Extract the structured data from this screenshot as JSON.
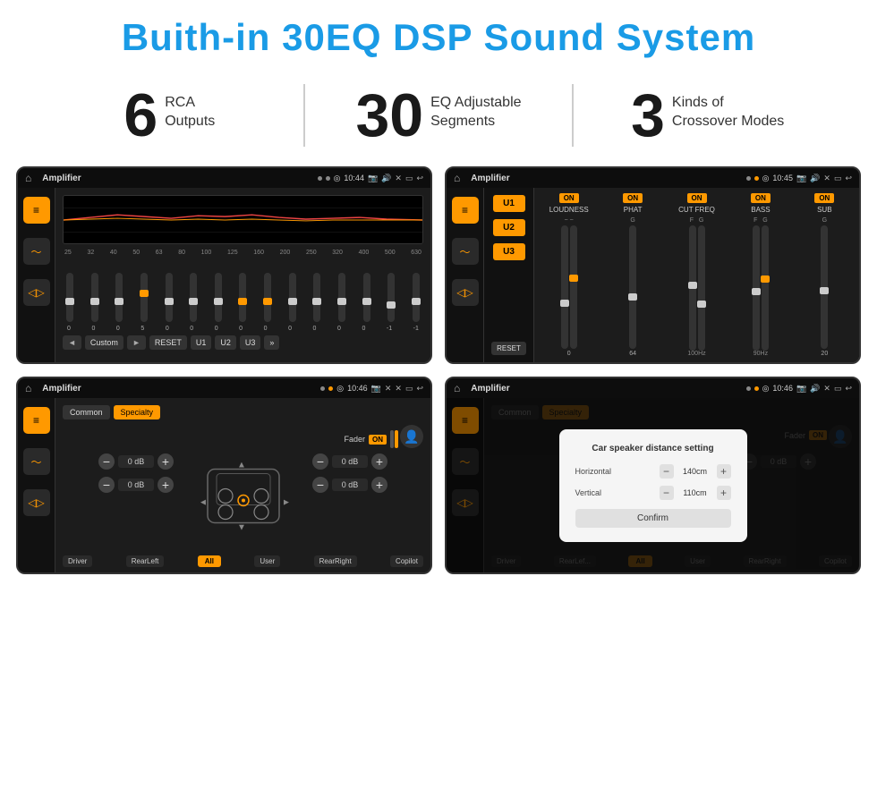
{
  "header": {
    "title": "Buith-in 30EQ DSP Sound System"
  },
  "stats": [
    {
      "number": "6",
      "label": "RCA\nOutputs"
    },
    {
      "number": "30",
      "label": "EQ Adjustable\nSegments"
    },
    {
      "number": "3",
      "label": "Kinds of\nCrossover Modes"
    }
  ],
  "screens": {
    "screen1": {
      "title": "Amplifier",
      "time": "10:44",
      "eq_freqs": [
        "25",
        "32",
        "40",
        "50",
        "63",
        "80",
        "100",
        "125",
        "160",
        "200",
        "250",
        "320",
        "400",
        "500",
        "630"
      ],
      "eq_values": [
        "0",
        "0",
        "0",
        "5",
        "0",
        "0",
        "0",
        "0",
        "0",
        "0",
        "0",
        "0",
        "0",
        "-1",
        "0",
        "-1"
      ],
      "preset": "Custom",
      "buttons": [
        "RESET",
        "U1",
        "U2",
        "U3"
      ]
    },
    "screen2": {
      "title": "Amplifier",
      "time": "10:45",
      "u_buttons": [
        "U1",
        "U2",
        "U3"
      ],
      "columns": [
        {
          "label": "LOUDNESS",
          "on": true
        },
        {
          "label": "PHAT",
          "on": true
        },
        {
          "label": "CUT FREQ",
          "on": true
        },
        {
          "label": "BASS",
          "on": true
        },
        {
          "label": "SUB",
          "on": true
        }
      ],
      "reset": "RESET"
    },
    "screen3": {
      "title": "Amplifier",
      "time": "10:46",
      "tabs": [
        "Common",
        "Specialty"
      ],
      "fader": "Fader",
      "fader_on": "ON",
      "db_rows": [
        {
          "left": "0 dB",
          "right": "0 dB"
        },
        {
          "left": "0 dB",
          "right": "0 dB"
        }
      ],
      "bottom_labels": [
        "Driver",
        "RearLeft",
        "All",
        "User",
        "RearRight",
        "Copilot"
      ]
    },
    "screen4": {
      "title": "Amplifier",
      "time": "10:46",
      "tabs": [
        "Common",
        "Specialty"
      ],
      "dialog": {
        "title": "Car speaker distance setting",
        "horizontal_label": "Horizontal",
        "horizontal_value": "140cm",
        "vertical_label": "Vertical",
        "vertical_value": "110cm",
        "confirm_label": "Confirm"
      },
      "db_right": "0 dB",
      "bottom_labels": [
        "Driver",
        "RearLef...",
        "All",
        "User",
        "RearRight",
        "Copilot"
      ]
    }
  }
}
